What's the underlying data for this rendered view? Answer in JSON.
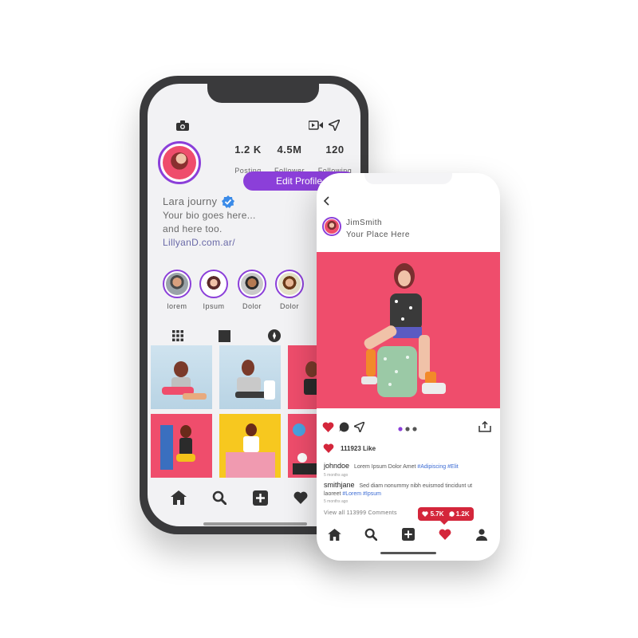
{
  "profile_screen": {
    "stats": [
      {
        "value": "1.2 K",
        "label": "Posting"
      },
      {
        "value": "4.5M",
        "label": "Follower"
      },
      {
        "value": "120",
        "label": "Following"
      }
    ],
    "edit_profile_label": "Edit Profile",
    "bio": {
      "name": "Lara journy",
      "line1": "Your bio goes here...",
      "line2": "and here too.",
      "link": "LillyanD.com.ar/"
    },
    "stories": [
      {
        "label": "lorem"
      },
      {
        "label": "Ipsum"
      },
      {
        "label": "Dolor"
      },
      {
        "label": "Dolor"
      }
    ],
    "tabs": [
      "grid-icon",
      "square-icon",
      "compass-icon"
    ],
    "nav": [
      "home-icon",
      "search-icon",
      "add-icon",
      "heart-icon"
    ]
  },
  "post_screen": {
    "username": "JimSmith",
    "location": "Your Place Here",
    "likes_text": "111923 Like",
    "comments": [
      {
        "user": "johndoe",
        "text": "Lorem Ipsum Dolor Amet",
        "tags": "#Adipiscing #Elit",
        "time": "5 months ago"
      },
      {
        "user": "smithjane",
        "text": "Sed diam nonummy nibh euismod tincidunt ut laoreet",
        "tags": "#Lorem #Ipsum",
        "time": "5 months ago"
      }
    ],
    "view_all": "View all 113999 Comments",
    "notification": {
      "likes": "5.7K",
      "comments": "1.2K"
    },
    "nav": [
      "home-icon",
      "search-icon",
      "add-icon",
      "heart-icon",
      "person-icon"
    ]
  },
  "colors": {
    "accent": "#8b3fd9",
    "heart": "#d4263b",
    "photo_bg": "#ef4d6c"
  }
}
